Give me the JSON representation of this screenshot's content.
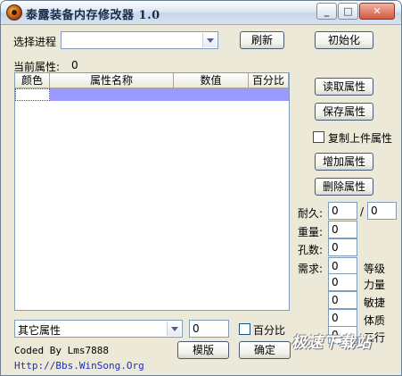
{
  "window": {
    "title": "泰露装备内存修改器 1.0",
    "minimize": "_",
    "maximize": "□",
    "close": "✕"
  },
  "process": {
    "label": "选择进程",
    "selected": "",
    "refresh_label": "刷新",
    "init_label": "初始化"
  },
  "current_attr": {
    "label": "当前属性:",
    "count": "0"
  },
  "table": {
    "columns": [
      "颜色",
      "属性名称",
      "数值",
      "百分比"
    ],
    "selected_row": [
      "",
      "",
      "",
      ""
    ]
  },
  "actions": {
    "read": "读取属性",
    "save": "保存属性",
    "copy_label": "复制上件属性",
    "add": "增加属性",
    "delete": "删除属性"
  },
  "stats": {
    "durability_label": "耐久:",
    "durability_current": "0",
    "durability_sep": "/",
    "durability_max": "0",
    "weight_label": "重量:",
    "weight": "0",
    "holes_label": "孔数:",
    "holes": "0",
    "require_label": "需求:",
    "requirements": [
      {
        "value": "0",
        "label": "等级"
      },
      {
        "value": "0",
        "label": "力量"
      },
      {
        "value": "0",
        "label": "敏捷"
      },
      {
        "value": "0",
        "label": "体质"
      },
      {
        "value": "0",
        "label": "五行"
      }
    ]
  },
  "bottom": {
    "other_attr": "其它属性",
    "other_value": "0",
    "percent_label": "百分比",
    "credit": "Coded By Lms7888",
    "url": "Http://Bbs.WinSong.Org",
    "template_label": "模版",
    "ok_label": "确定"
  },
  "watermark": "极速下载站"
}
